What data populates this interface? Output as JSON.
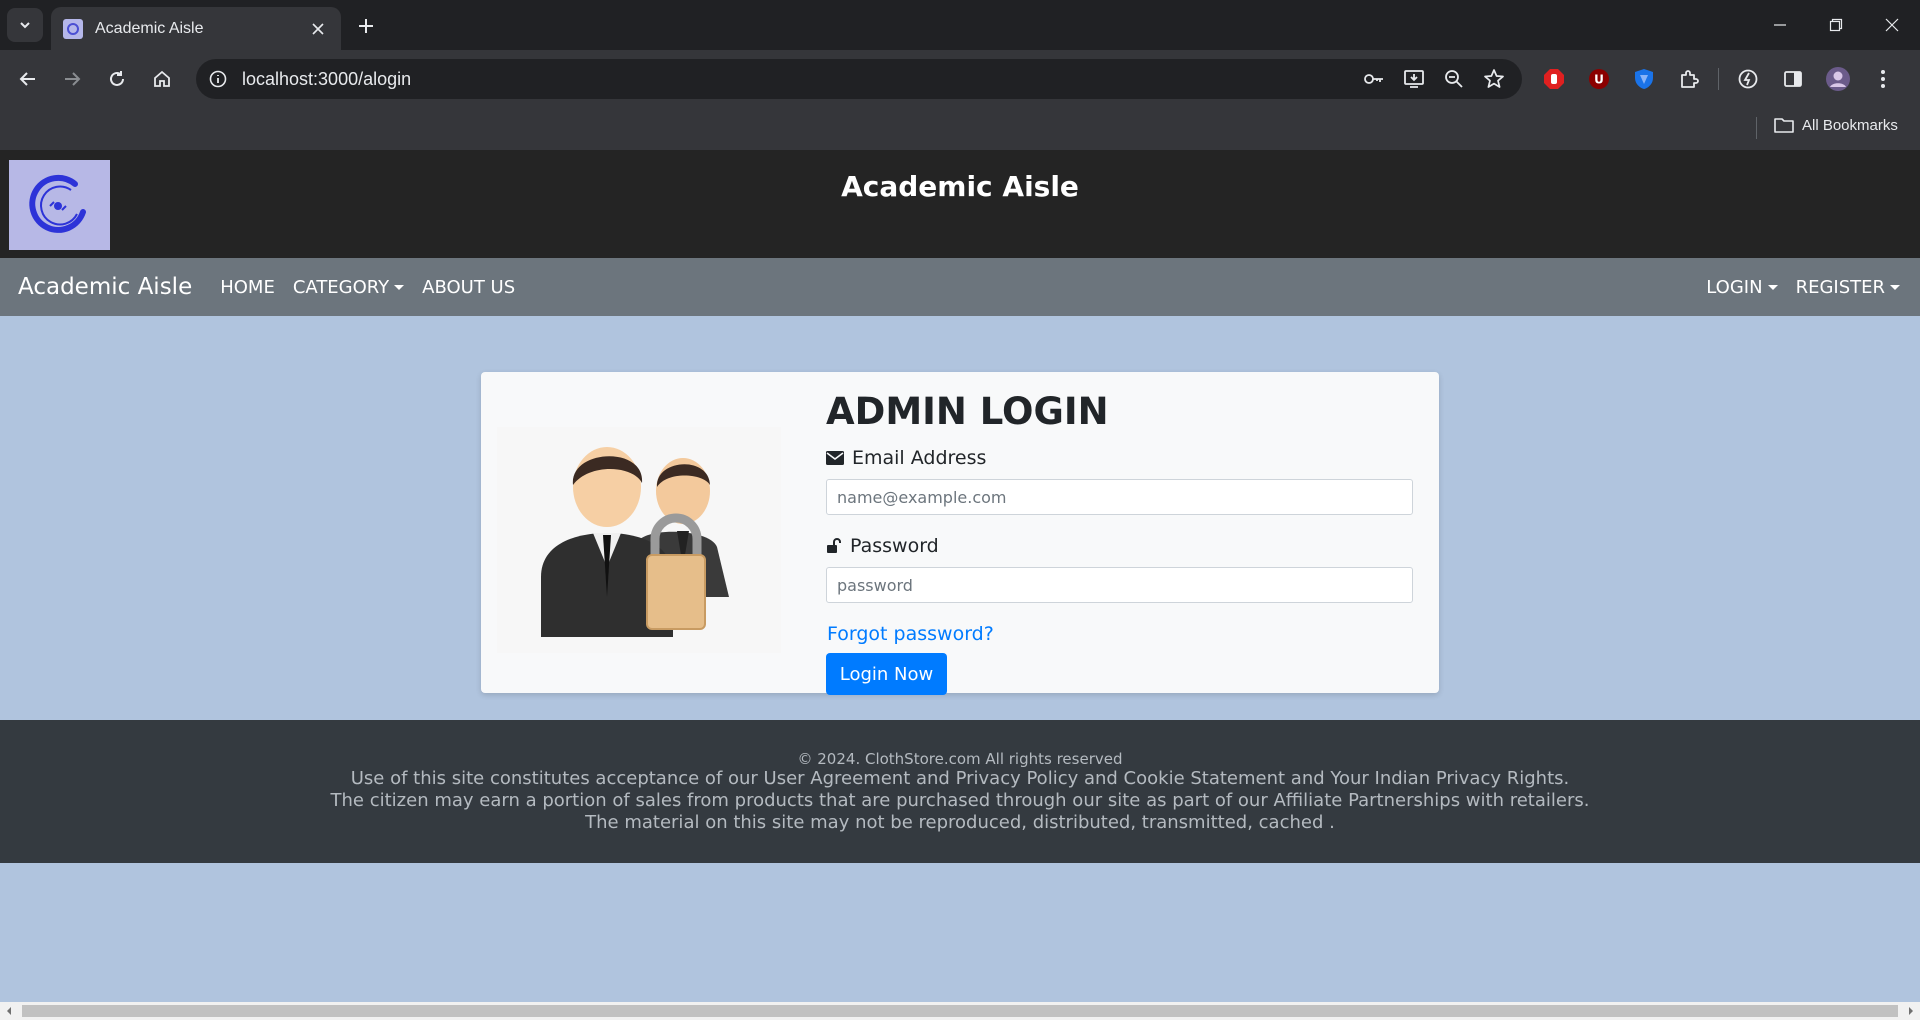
{
  "browser": {
    "tab_title": "Academic Aisle",
    "url": "localhost:3000/alogin",
    "bookmarks_label": "All Bookmarks"
  },
  "site": {
    "header_title": "Academic Aisle",
    "nav": {
      "brand": "Academic Aisle",
      "links": [
        "HOME",
        "CATEGORY",
        "ABOUT US"
      ],
      "right_links": [
        "LOGIN",
        "REGISTER"
      ]
    }
  },
  "login": {
    "title": "ADMIN LOGIN",
    "email_label": "Email Address",
    "email_placeholder": "name@example.com",
    "password_label": "Password",
    "password_placeholder": "password",
    "forgot": "Forgot password?",
    "button": "Login Now"
  },
  "footer": {
    "copyright": "© 2024. ClothStore.com All rights reserved",
    "lines": [
      "Use of this site constitutes acceptance of our User Agreement and Privacy Policy and Cookie Statement and Your Indian Privacy Rights.",
      "The citizen may earn a portion of sales from products that are purchased through our site as part of our Affiliate Partnerships with retailers.",
      "The material on this site may not be reproduced, distributed, transmitted, cached ."
    ]
  },
  "colors": {
    "page_bg": "#b0c4de",
    "header_bg": "#242424",
    "navbar_bg": "#6c757d",
    "primary": "#007bff",
    "footer_bg": "#343a40"
  }
}
